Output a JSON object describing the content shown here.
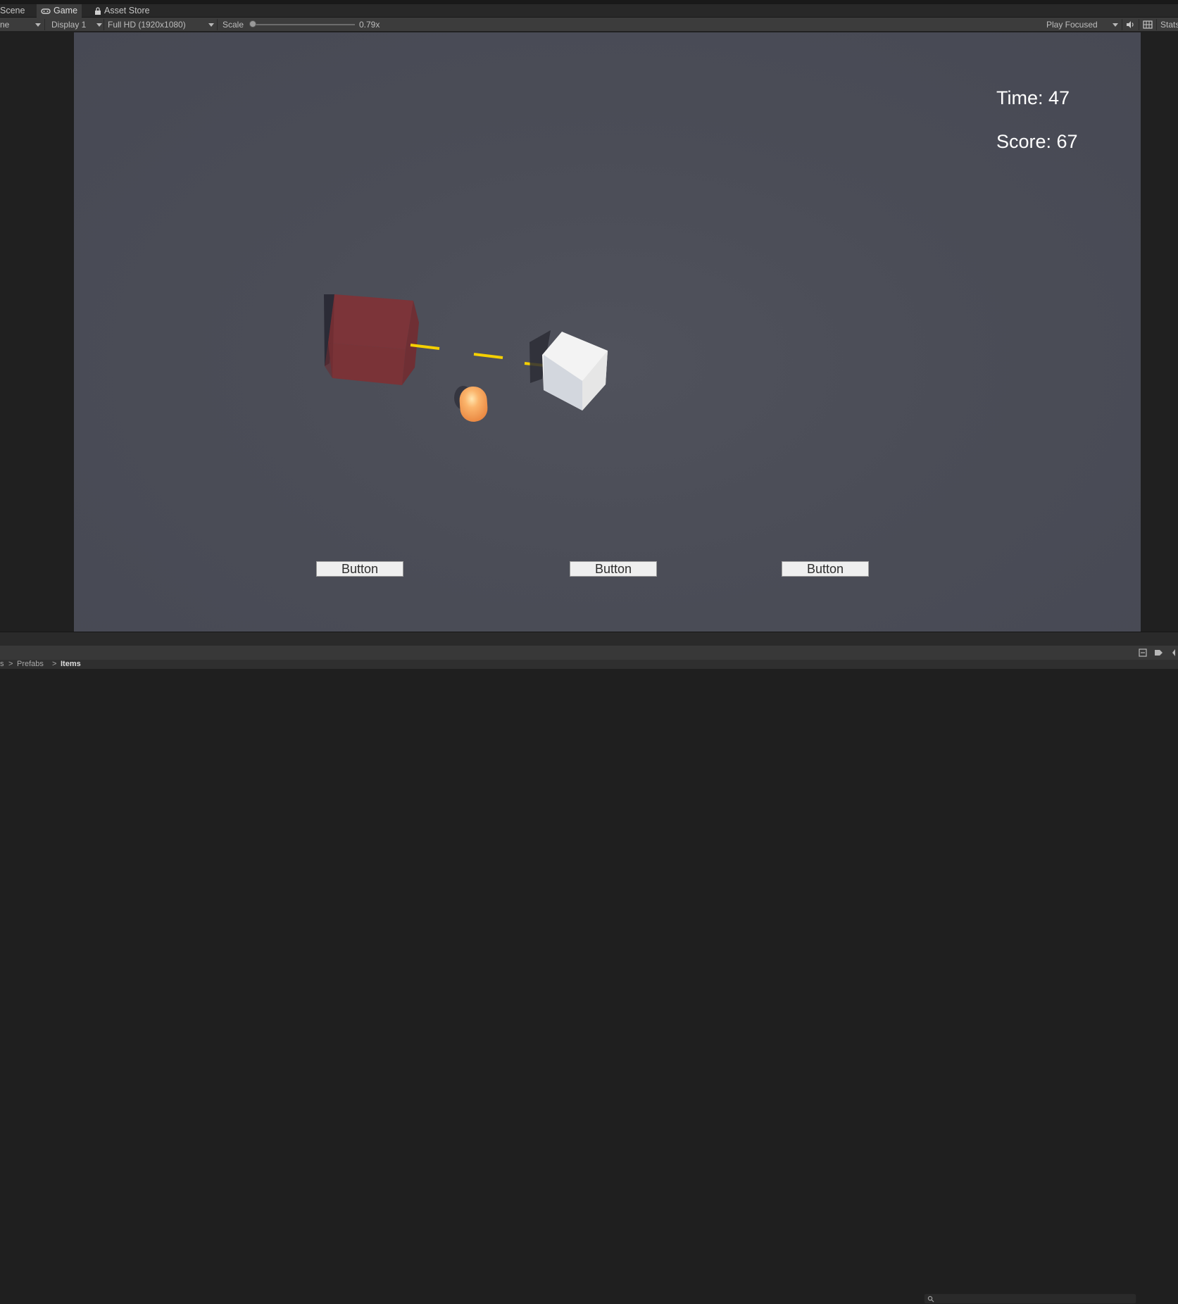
{
  "tabs": [
    {
      "label": "Scene",
      "icon": "scene-icon"
    },
    {
      "label": "Game",
      "icon": "gamepad-icon",
      "active": true
    },
    {
      "label": "Asset Store",
      "icon": "lock-icon"
    }
  ],
  "toolbar": {
    "mode_partial": "ne",
    "display": "Display 1",
    "resolution": "Full HD (1920x1080)",
    "scale_label": "Scale",
    "scale_value": "0.79x",
    "play_mode": "Play Focused",
    "stats_partial": "Stats",
    "icons": [
      "audio-icon",
      "gizmo-grid-icon"
    ]
  },
  "hud": {
    "time": "Time: 47",
    "score": "Score: 67"
  },
  "game_buttons": [
    {
      "label": "Button"
    },
    {
      "label": "Button"
    },
    {
      "label": "Button"
    }
  ],
  "scene_objects": {
    "red_cube_color": "#7a3438",
    "white_cube_color": "#f2f2f2",
    "capsule_color": "#f6a45c",
    "laser_color": "#f5d000"
  },
  "breadcrumb": {
    "items": [
      "s",
      "Prefabs",
      "Items"
    ]
  },
  "colors": {
    "editor_bg": "#3c3c3c",
    "viewport_bg": "#4b4d57",
    "hud_text": "#ffffff"
  }
}
